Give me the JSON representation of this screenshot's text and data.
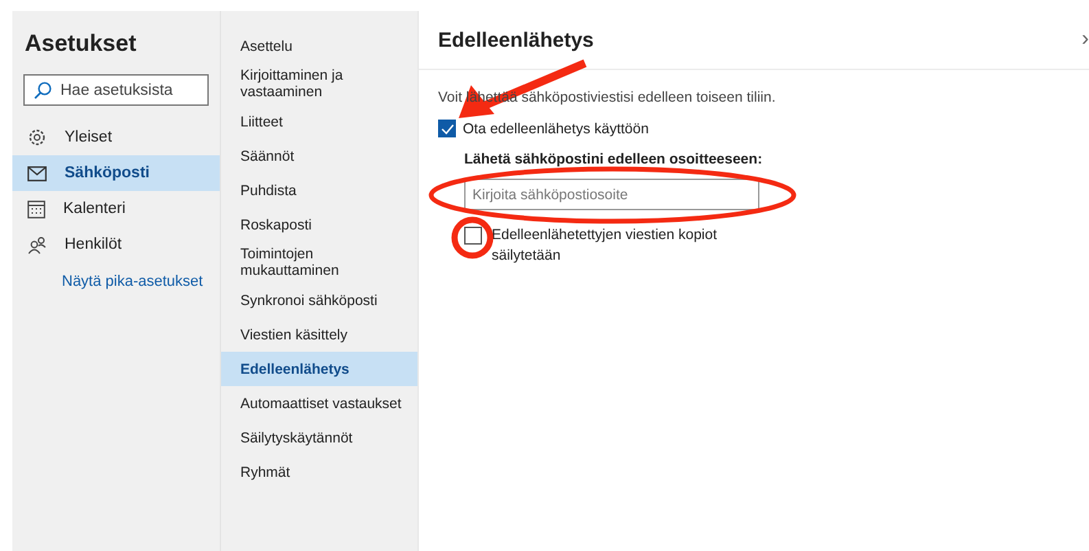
{
  "settings": {
    "title": "Asetukset",
    "search": {
      "placeholder": "Hae asetuksista"
    },
    "categories": [
      {
        "label": "Yleiset",
        "selected": false
      },
      {
        "label": "Sähköposti",
        "selected": true
      },
      {
        "label": "Kalenteri",
        "selected": false
      },
      {
        "label": "Henkilöt",
        "selected": false
      }
    ],
    "quick_link": "Näytä pika-asetukset"
  },
  "subnav": [
    {
      "label": "Asettelu",
      "selected": false
    },
    {
      "label": "Kirjoittaminen ja vastaaminen",
      "selected": false
    },
    {
      "label": "Liitteet",
      "selected": false
    },
    {
      "label": "Säännöt",
      "selected": false
    },
    {
      "label": "Puhdista",
      "selected": false
    },
    {
      "label": "Roskaposti",
      "selected": false
    },
    {
      "label": "Toimintojen mukauttaminen",
      "selected": false
    },
    {
      "label": "Synkronoi sähköposti",
      "selected": false
    },
    {
      "label": "Viestien käsittely",
      "selected": false
    },
    {
      "label": "Edelleenlähetys",
      "selected": true
    },
    {
      "label": "Automaattiset vastaukset",
      "selected": false
    },
    {
      "label": "Säilytyskäytännöt",
      "selected": false
    },
    {
      "label": "Ryhmät",
      "selected": false
    }
  ],
  "panel": {
    "title": "Edelleenlähetys",
    "expand_icon": "›",
    "description": "Voit lähettää sähköpostiviestisi edelleen toiseen tiliin.",
    "enable": {
      "label": "Ota edelleenlähetys käyttöön",
      "checked": true
    },
    "address_label": "Lähetä sähköpostini edelleen osoitteeseen:",
    "address": {
      "placeholder": "Kirjoita sähköpostiosoite"
    },
    "keep_copy": {
      "label": "Edelleenlähetettyjen viestien kopiot säilytetään",
      "checked": false
    }
  }
}
